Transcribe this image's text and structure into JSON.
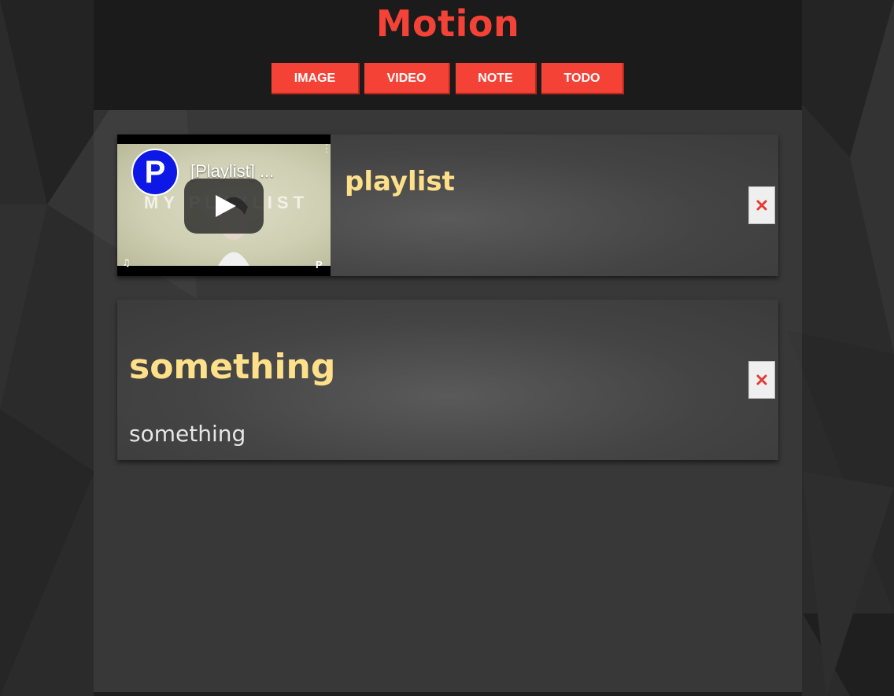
{
  "app": {
    "title": "Motion"
  },
  "nav": {
    "buttons": [
      "IMAGE",
      "VIDEO",
      "NOTE",
      "TODO"
    ]
  },
  "items": [
    {
      "type": "video",
      "title": "playlist",
      "video": {
        "title": "[Playlist] ...",
        "channel_logo": "P",
        "thumbnail_text": "MY PLAYLIST",
        "watermark": "P"
      }
    },
    {
      "type": "note",
      "title": "something",
      "body": "something"
    }
  ],
  "colors": {
    "accent": "#f44336",
    "card_title": "#ffe08a",
    "header_bg": "#1b1b1b"
  }
}
